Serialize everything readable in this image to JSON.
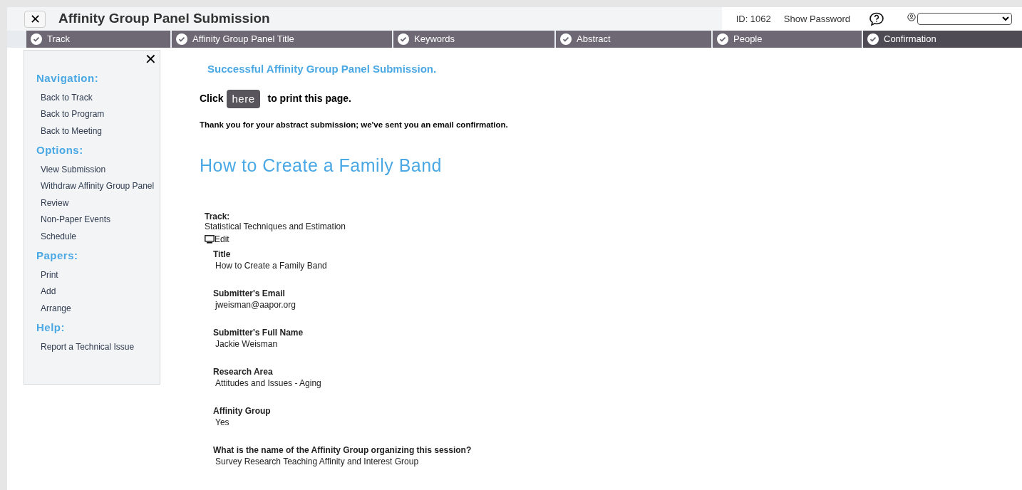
{
  "header": {
    "close_label": "✕",
    "title": "Affinity Group Panel Submission",
    "id": "ID: 1062",
    "show_password": "Show Password"
  },
  "steps": [
    {
      "label": "Track",
      "done": true,
      "selected": false
    },
    {
      "label": "Affinity Group Panel Title",
      "done": true,
      "selected": false
    },
    {
      "label": "Keywords",
      "done": true,
      "selected": false
    },
    {
      "label": "Abstract",
      "done": true,
      "selected": false
    },
    {
      "label": "People",
      "done": true,
      "selected": false
    },
    {
      "label": "Confirmation",
      "done": true,
      "selected": true
    }
  ],
  "sidebar": {
    "close_label": "✕",
    "sections": [
      {
        "heading": "Navigation:",
        "items": [
          "Back to Track",
          "Back to Program",
          "Back to Meeting"
        ]
      },
      {
        "heading": "Options:",
        "items": [
          "View Submission",
          "Withdraw Affinity Group Panel",
          "Review",
          "Non-Paper Events",
          "Schedule"
        ]
      },
      {
        "heading": "Papers:",
        "items": [
          "Print",
          "Add",
          "Arrange"
        ]
      },
      {
        "heading": "Help:",
        "items": [
          "Report a Technical Issue"
        ]
      }
    ]
  },
  "content": {
    "success": "Successful Affinity Group Panel Submission.",
    "print_before": "Click",
    "print_button": "here",
    "print_after": "to print this page.",
    "thanks": "Thank you for your abstract submission; we've sent you an email confirmation.",
    "heading": "How to Create a Family Band",
    "track_label": "Track:",
    "track_value": "Statistical Techniques and Estimation",
    "edit": "Edit",
    "fields": [
      {
        "label": "Title",
        "value": "How to Create a Family Band"
      },
      {
        "label": "Submitter's Email",
        "value": "jweisman@aapor.org"
      },
      {
        "label": "Submitter's Full Name",
        "value": "Jackie Weisman"
      },
      {
        "label": "Research Area",
        "value": "Attitudes and Issues - Aging"
      },
      {
        "label": "Affinity Group",
        "value": "Yes"
      },
      {
        "label": "What is the name of the Affinity Group organizing this session?",
        "value": "Survey Research Teaching Affinity and Interest Group"
      }
    ]
  }
}
